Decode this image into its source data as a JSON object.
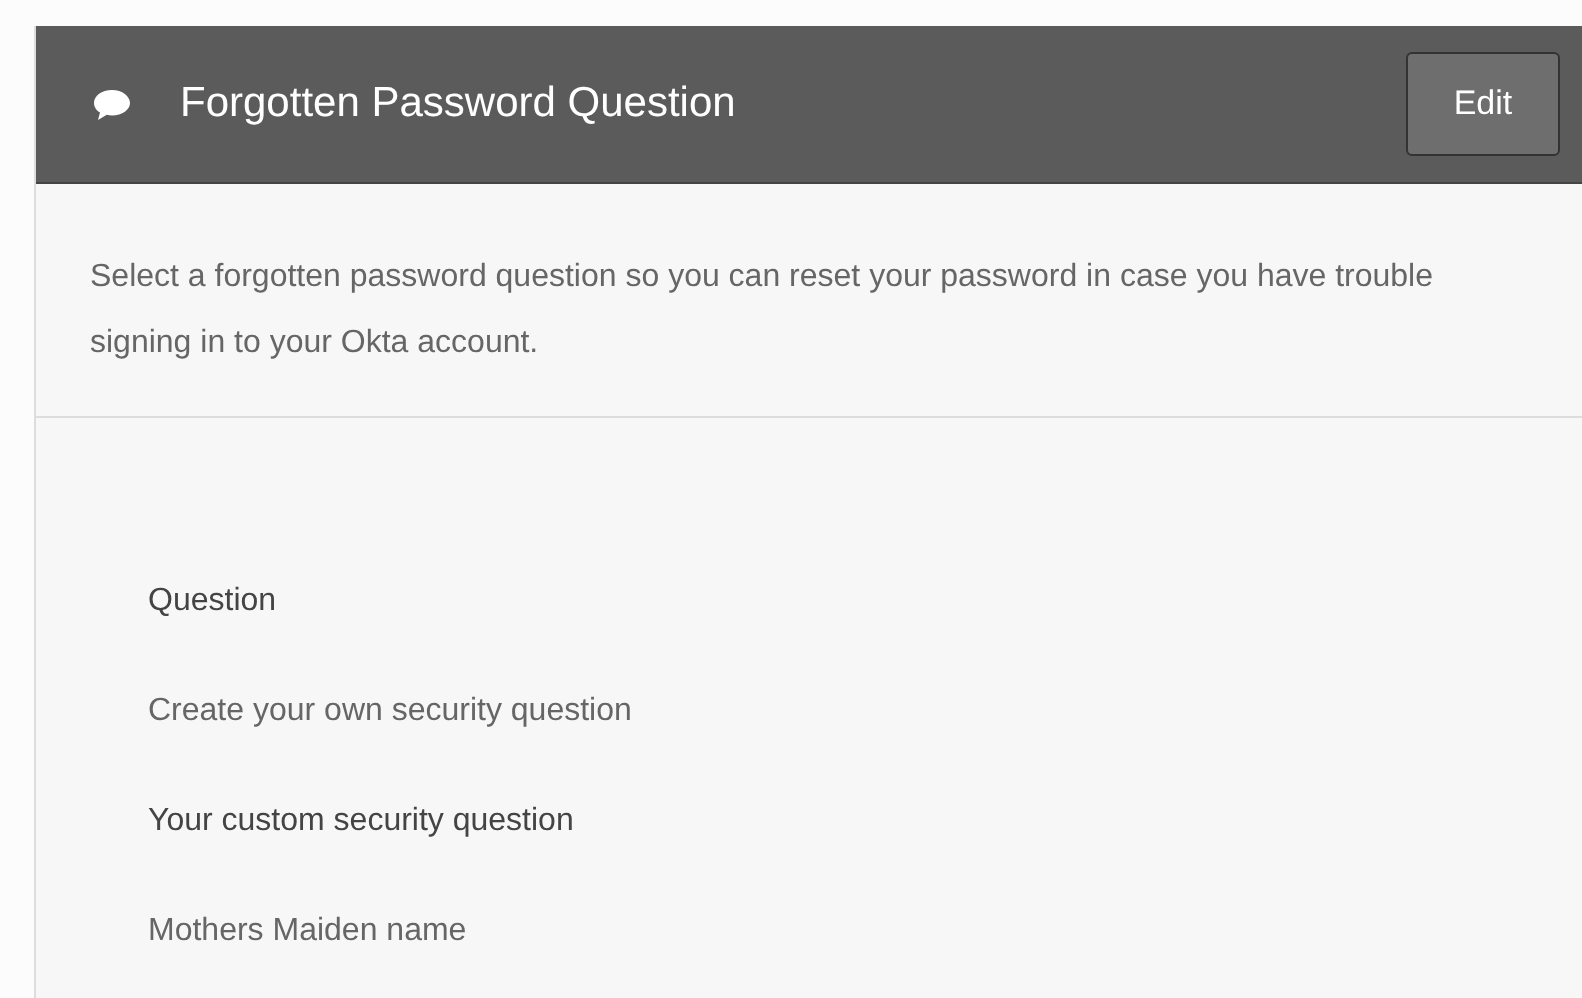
{
  "panel": {
    "title": "Forgotten Password Question",
    "edit_button": "Edit"
  },
  "description": "Select a forgotten password question so you can reset your password in case you have trouble signing in to your Okta account.",
  "fields": [
    {
      "label": "Question",
      "value": "Create your own security question"
    },
    {
      "label": "Your custom security question",
      "value": "Mothers Maiden name"
    }
  ]
}
